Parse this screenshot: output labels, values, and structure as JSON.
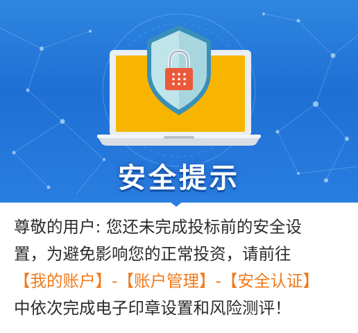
{
  "banner": {
    "title": "安全提示"
  },
  "message": {
    "line1": "尊敬的用户: 您还未完成投标前的安全设",
    "line2": "置，为避免影响您的正常投资，请前往",
    "links": [
      {
        "label": "【我的账户】"
      },
      {
        "label": "【账户管理】"
      },
      {
        "label": "【安全认证】"
      }
    ],
    "separator": "-",
    "line4": "中依次完成电子印章设置和风险测评！"
  },
  "colors": {
    "banner_blue": "#1f6fd4",
    "laptop_screen": "#f7b500",
    "shield_teal": "#bfe4ea",
    "lock_red": "#ea5a3a",
    "link_orange": "#f07a1c",
    "text": "#2b2b2b"
  },
  "icons": {
    "illustration": "laptop-shield-lock-icon"
  }
}
